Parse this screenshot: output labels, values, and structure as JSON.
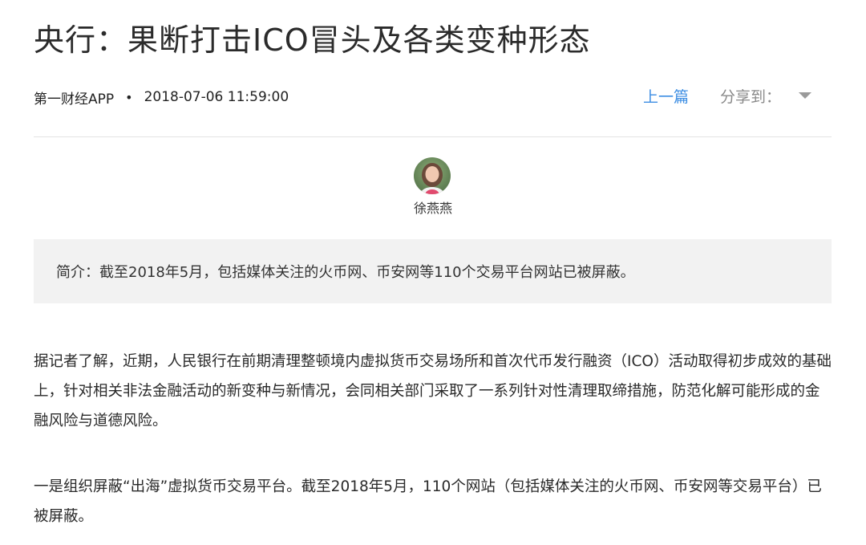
{
  "article": {
    "title": "央行：果断打击ICO冒头及各类变种形态",
    "source": "第一财经APP",
    "separator": "•",
    "datetime": "2018-07-06 11:59:00",
    "prev_label": "上一篇",
    "share_label": "分享到：",
    "author": {
      "name": "徐燕燕",
      "avatar_icon": "author-avatar-photo"
    },
    "summary": "简介：截至2018年5月，包括媒体关注的火币网、币安网等110个交易平台网站已被屏蔽。",
    "paragraphs": [
      "据记者了解，近期，人民银行在前期清理整顿境内虚拟货币交易场所和首次代币发行融资（ICO）活动取得初步成效的基础上，针对相关非法金融活动的新变种与新情况，会同相关部门采取了一系列针对性清理取缔措施，防范化解可能形成的金融风险与道德风险。",
      "一是组织屏蔽“出海”虚拟货币交易平台。截至2018年5月，110个网站（包括媒体关注的火币网、币安网等交易平台）已被屏蔽。"
    ]
  },
  "colors": {
    "link": "#3d8ee3",
    "muted": "#8a8a8a",
    "summary_bg": "#f2f2f2",
    "divider": "#e3e3e3"
  }
}
